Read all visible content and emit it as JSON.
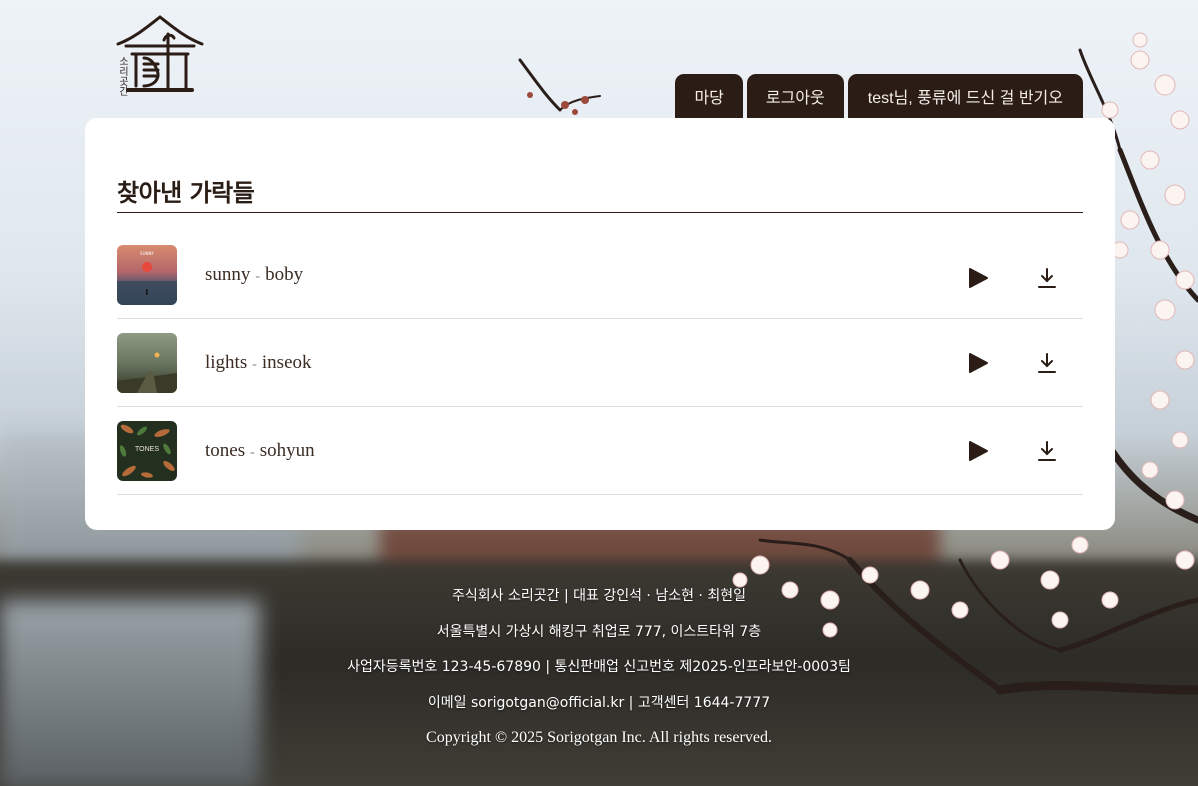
{
  "header": {
    "logo_text": "소리곳간",
    "nav": [
      {
        "label": "마당"
      },
      {
        "label": "로그아웃"
      },
      {
        "label": "test님, 풍류에 드신 걸 반기오"
      }
    ]
  },
  "main": {
    "title": "찾아낸 가락들",
    "tracks": [
      {
        "title": "sunny",
        "separator": "-",
        "artist": "boby",
        "cover_text": "SUNNY",
        "play_icon": "play-icon",
        "download_icon": "download-icon"
      },
      {
        "title": "lights",
        "separator": "-",
        "artist": "inseok",
        "cover_text": "",
        "play_icon": "play-icon",
        "download_icon": "download-icon"
      },
      {
        "title": "tones",
        "separator": "-",
        "artist": "sohyun",
        "cover_text": "TONES",
        "play_icon": "play-icon",
        "download_icon": "download-icon"
      }
    ]
  },
  "footer": {
    "line1": "주식회사 소리곳간 | 대표 강인석 · 남소현 · 최현일",
    "line2": "서울특별시 가상시 해킹구 취업로 777, 이스트타워 7층",
    "line3": "사업자등록번호 123-45-67890 | 통신판매업 신고번호 제2025-인프라보안-0003팀",
    "line4": "이메일 sorigotgan@official.kr | 고객센터 1644-7777",
    "copyright": "Copyright © 2025 Sorigotgan Inc. All rights reserved."
  },
  "colors": {
    "brand_dark": "#2b1d16",
    "card_bg": "#ffffff",
    "footer_text": "#ffffff"
  }
}
